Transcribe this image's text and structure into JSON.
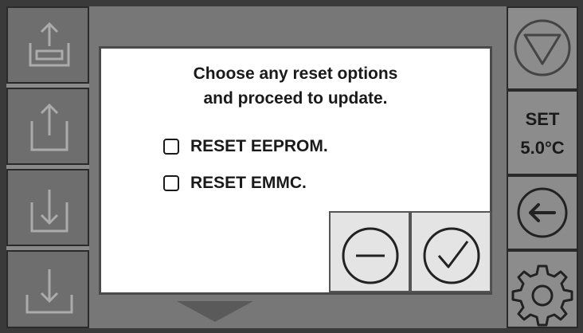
{
  "dialog": {
    "message_line1": "Choose any reset options",
    "message_line2": "and proceed to update.",
    "options": [
      {
        "label": "RESET EEPROM.",
        "checked": false
      },
      {
        "label": "RESET EMMC.",
        "checked": false
      }
    ],
    "cancel_icon": "minus-circle-icon",
    "confirm_icon": "check-circle-icon"
  },
  "right_panel": {
    "set_label": "SET",
    "set_value": "5.0°C",
    "icons": [
      "triangle-down-circle-icon",
      "arrow-left-circle-icon",
      "gear-icon"
    ]
  },
  "left_panel": {
    "icons": [
      "tray-upload-icon",
      "box-upload-icon",
      "box-download-icon",
      "tray-download-icon"
    ]
  },
  "colors": {
    "dialog_bg": "#ffffff",
    "panel_bg": "#8c8c8c",
    "text": "#1a1a1a"
  }
}
